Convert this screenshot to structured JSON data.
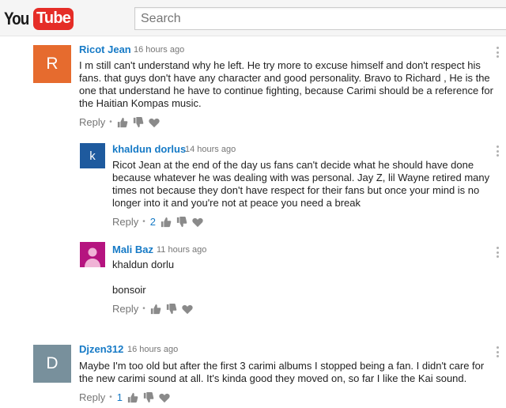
{
  "header": {
    "logo_you": "You",
    "logo_tube": "Tube",
    "search_placeholder": "Search"
  },
  "colors": {
    "link_blue": "#167ac6",
    "youtube_red": "#e52d27",
    "avatar_orange": "#e66b2e",
    "avatar_navy": "#1e5a9e",
    "avatar_magenta": "#b5147f",
    "avatar_slate": "#78909c"
  },
  "comments": [
    {
      "author": "Ricot Jean",
      "time": "16 hours ago",
      "avatar_letter": "R",
      "text": "I m still can't understand why he left. He try more to excuse himself and don't respect his fans. that guys don't have any character and good personality. Bravo to Richard , He is the one that understand he have to continue fighting, because Carimi should be a reference for the Haitian Kompas music.",
      "reply_label": "Reply",
      "like_count": ""
    },
    {
      "author": "khaldun dorlus",
      "time": "14 hours ago",
      "avatar_letter": "k",
      "text": "Ricot Jean at the end of the day us fans can't decide what he should have done because whatever he was dealing with was personal. Jay Z, lil Wayne retired many times not because they don't have respect for their fans but once your mind is no longer into it and you're not at peace you need a break",
      "reply_label": "Reply",
      "like_count": "2"
    },
    {
      "author": "Mali Baz",
      "time": "11 hours ago",
      "avatar_icon": "default-person-icon",
      "text_line1": "khaldun dorlu",
      "text_line2": "bonsoir",
      "reply_label": "Reply",
      "like_count": ""
    },
    {
      "author": "Djzen312",
      "time": "16 hours ago",
      "avatar_letter": "D",
      "text": "Maybe I'm too old but after the  first 3 carimi albums I stopped being a fan. I didn't care for the new carimi sound at all. It's kinda good they moved on, so far I like the Kai sound.",
      "reply_label": "Reply",
      "like_count": "1"
    }
  ]
}
